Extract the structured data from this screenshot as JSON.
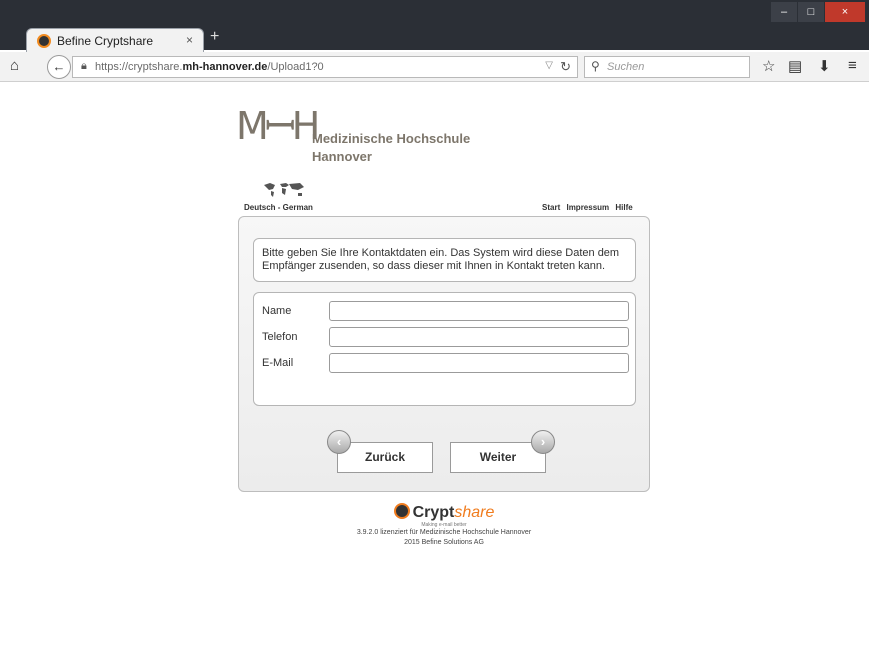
{
  "browser": {
    "tab_title": "Befine Cryptshare",
    "tab_close_icon": "×",
    "new_tab_icon": "+",
    "window_controls": [
      "–",
      "□",
      "×"
    ],
    "url_prefix": "https://cryptshare.",
    "url_domain": "mh-hannover.de",
    "url_path": "/Upload1?0",
    "search_placeholder": "Suchen",
    "icons": [
      "home-icon",
      "back-icon",
      "lock-icon",
      "reload-icon",
      "bookmark-star-icon",
      "reading-list-icon",
      "download-icon",
      "menu-icon"
    ]
  },
  "logo": {
    "mark": "MꟷH",
    "line1": "Medizinische Hochschule",
    "line2": "Hannover"
  },
  "language": {
    "label": "Deutsch - German"
  },
  "toplinks": {
    "start": "Start",
    "impressum": "Impressum",
    "hilfe": "Hilfe"
  },
  "info_text": "Bitte geben Sie Ihre Kontaktdaten ein. Das System wird diese Daten dem Empfänger zusenden, so dass dieser mit Ihnen in Kontakt treten kann.",
  "form": {
    "name_label": "Name",
    "name_value": "",
    "phone_label": "Telefon",
    "phone_value": "",
    "email_label": "E-Mail",
    "email_value": ""
  },
  "buttons": {
    "back": "Zurück",
    "next": "Weiter"
  },
  "footer": {
    "brand_main": "Crypt",
    "brand_accent": "share",
    "tagline": "Making e-mail better",
    "license": "3.9.2.0 lizenziert für Medizinische Hochschule Hannover",
    "copyright": "2015 Befine Solutions AG"
  },
  "colors": {
    "accent": "#f07c1e",
    "logo_gray": "#7d766b"
  }
}
